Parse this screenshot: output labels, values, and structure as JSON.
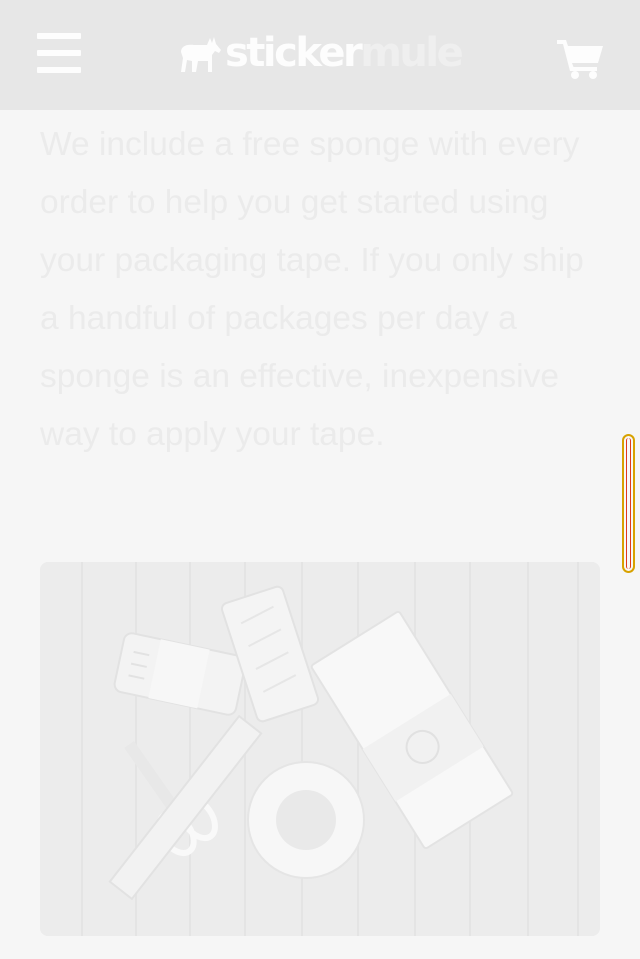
{
  "header": {
    "menu_icon": "hamburger-menu-icon",
    "logo": {
      "part1": "sticker",
      "part2": "mule",
      "icon": "mule-logo-icon"
    },
    "cart_icon": "shopping-cart-icon"
  },
  "content": {
    "paragraph": "We include a free sponge with every order to help you get started using your packaging tape. If you only ship a handful of packages per day a sponge is an effective, inexpensive way to apply your tape.",
    "image": {
      "description_icon": "packaging-tape-photo"
    }
  },
  "colors": {
    "header_bg": "#e7e7e7",
    "page_bg": "#f6f6f6",
    "text": "#ebebeb",
    "scroll_outline": "#d8a200"
  }
}
